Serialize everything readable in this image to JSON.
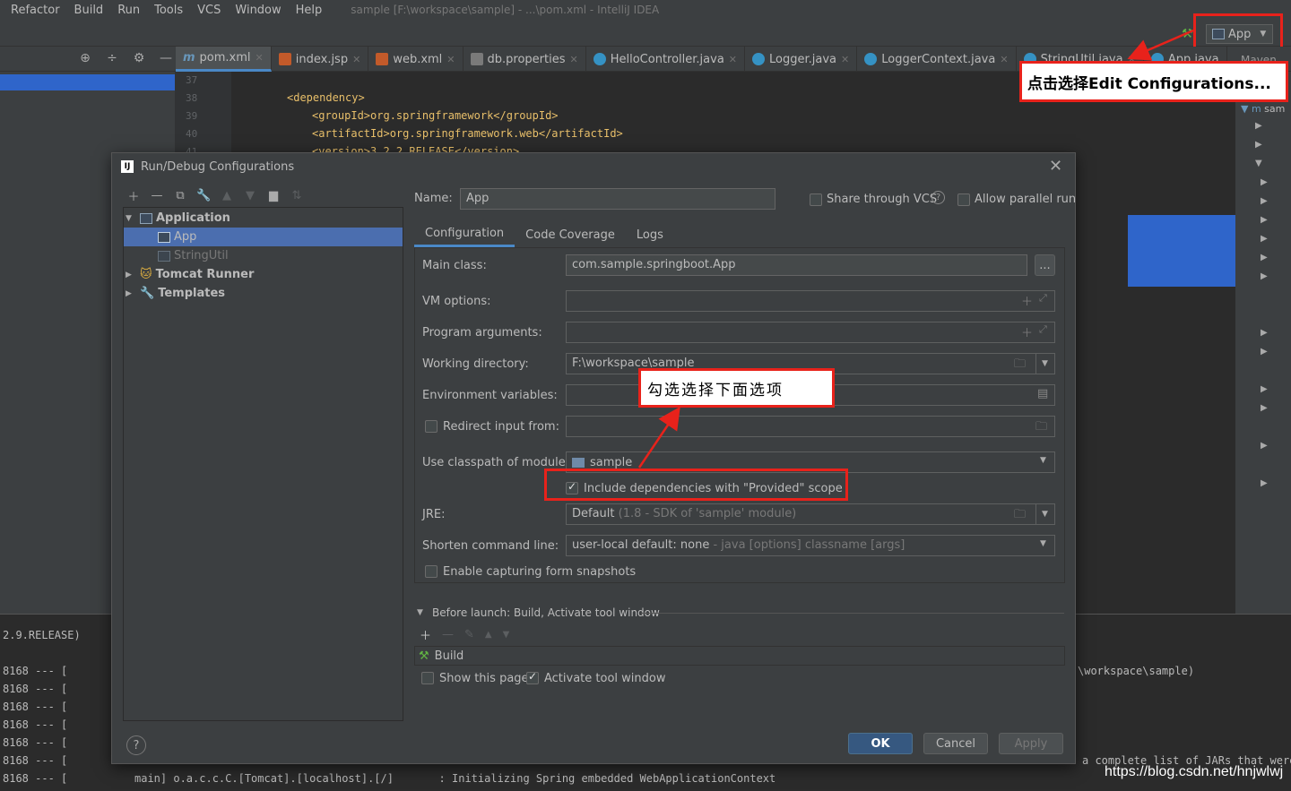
{
  "menu": [
    "Refactor",
    "Build",
    "Run",
    "Tools",
    "VCS",
    "Window",
    "Help"
  ],
  "window_title": "sample [F:\\workspace\\sample] - ...\\pom.xml - IntelliJ IDEA",
  "run_config": "App",
  "tabs": [
    "pom.xml",
    "index.jsp",
    "web.xml",
    "db.properties",
    "HelloController.java",
    "Logger.java",
    "LoggerContext.java",
    "StringUtil.java",
    "App.java"
  ],
  "maven_label": "Maven",
  "maven_tree_label": "sam",
  "code_lines": [
    {
      "num": "37",
      "text": ""
    },
    {
      "num": "38",
      "text": "<dependency>"
    },
    {
      "num": "39",
      "text": "<groupId>org.springframework</groupId>"
    },
    {
      "num": "40",
      "text": "<artifactId>org.springframework.web</artifactId>"
    },
    {
      "num": "41",
      "text": "<version>3.2.2.RELEASE</version>"
    }
  ],
  "dialog": {
    "title": "Run/Debug Configurations",
    "tree": {
      "application": "Application",
      "app": "App",
      "stringutil": "StringUtil",
      "tomcat": "Tomcat Runner",
      "templates": "Templates"
    },
    "name_label": "Name:",
    "name_value": "App",
    "share_vcs": "Share through VCS",
    "allow_parallel": "Allow parallel run",
    "tabs": [
      "Configuration",
      "Code Coverage",
      "Logs"
    ],
    "main_class_label": "Main class:",
    "main_class_value": "com.sample.springboot.App",
    "vm_options_label": "VM options:",
    "program_args_label": "Program arguments:",
    "working_dir_label": "Working directory:",
    "working_dir_value": "F:\\workspace\\sample",
    "env_vars_label": "Environment variables:",
    "redirect_label": "Redirect input from:",
    "classpath_label": "Use classpath of module:",
    "classpath_value": "sample",
    "include_provided": "Include dependencies with \"Provided\" scope",
    "jre_label": "JRE:",
    "jre_value": "Default",
    "jre_hint": "(1.8 - SDK of 'sample' module)",
    "shorten_label": "Shorten command line:",
    "shorten_value": "user-local default: none",
    "shorten_hint": "- java [options] classname [args]",
    "snapshots": "Enable capturing form snapshots",
    "before_launch": "Before launch: Build, Activate tool window",
    "build_item": "Build",
    "show_page": "Show this page",
    "activate_tool": "Activate tool window",
    "ok": "OK",
    "cancel": "Cancel",
    "apply": "Apply",
    "browse": "..."
  },
  "annotations": {
    "edit_config": "点击选择Edit Configurations...",
    "check_below": "勾选选择下面选项"
  },
  "console": {
    "line_top": "2.9.RELEASE)",
    "lines": [
      "8168 --- [",
      "8168 --- [",
      "8168 --- [",
      "8168 --- [",
      "8168 --- [",
      "8168 --- [",
      "8168 --- ["
    ],
    "last_line": "main] o.a.c.c.C.[Tomcat].[localhost].[/]       : Initializing Spring embedded WebApplicationContext",
    "right_1": "\\workspace\\sample)",
    "right_2": "a complete list of JARs that were"
  },
  "watermark": "https://blog.csdn.net/hnjwlwj"
}
